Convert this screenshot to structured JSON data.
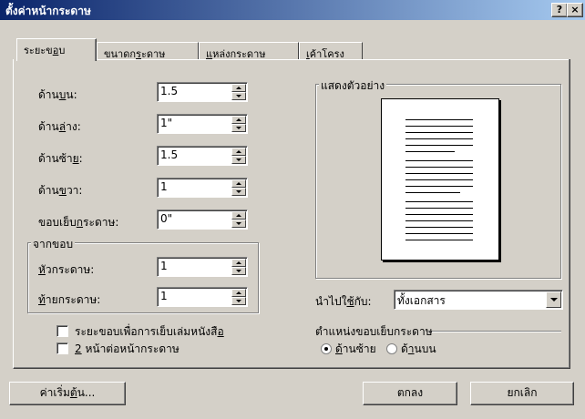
{
  "window": {
    "title": "ตั้งค่าหน้ากระดาษ",
    "help_label": "?",
    "close_label": "×"
  },
  "tabs": [
    {
      "pre": "ระยะข",
      "u": "อ",
      "post": "บ"
    },
    {
      "pre": "ขนาดก",
      "u": "ร",
      "post": "ะดาษ"
    },
    {
      "pre": "",
      "u": "แ",
      "post": "หล่งกระดาษ"
    },
    {
      "pre": "",
      "u": "เ",
      "post": "ค้าโครง"
    }
  ],
  "margins": {
    "top": {
      "pre": "ด้าน",
      "u": "บ",
      "post": "น:",
      "value": "1.5"
    },
    "bottom": {
      "pre": "ด้าน",
      "u": "ล่",
      "post": "าง:",
      "value": "1\""
    },
    "left": {
      "pre": "ด้านซ้า",
      "u": "ย",
      "post": ":",
      "value": "1.5"
    },
    "right": {
      "pre": "ด้าน",
      "u": "ข",
      "post": "วา:",
      "value": "1"
    },
    "gutter": {
      "pre": "ขอบเย็บ",
      "u": "ก",
      "post": "ระดาษ:",
      "value": "0\""
    }
  },
  "from_edge": {
    "legend": "จากขอบ",
    "header": {
      "pre": "",
      "u": "หั",
      "post": "วกระดาษ:",
      "value": "1"
    },
    "footer": {
      "pre": "",
      "u": "ท้",
      "post": "ายกระดาษ:",
      "value": "1"
    }
  },
  "preview": {
    "legend": "แสดงตัวอย่าง"
  },
  "apply_to": {
    "pre": "นำไปใ",
    "u": "ช้",
    "post": "กับ:",
    "value": "ทั้งเอกสาร"
  },
  "checkboxes": [
    {
      "pre": "ระยะขอบเพื่อการเย็บเล่มหนังสื",
      "u": "อ",
      "post": "",
      "checked": false
    },
    {
      "pre": "",
      "u": "2",
      "post": " หน้าต่อหน้ากระดาษ",
      "checked": false
    }
  ],
  "gutter_position": {
    "legend": "ตำแหน่งขอบเย็บกระดาษ",
    "options": [
      {
        "pre": "",
        "u": "ด้",
        "post": "านซ้าย",
        "selected": true
      },
      {
        "pre": "ด้",
        "u": "า",
        "post": "นบน",
        "selected": false
      }
    ]
  },
  "buttons": {
    "default": {
      "pre": "ค่าเริ่ม",
      "u": "ต้",
      "post": "น..."
    },
    "ok": "ตกลง",
    "cancel": "ยกเลิก"
  }
}
